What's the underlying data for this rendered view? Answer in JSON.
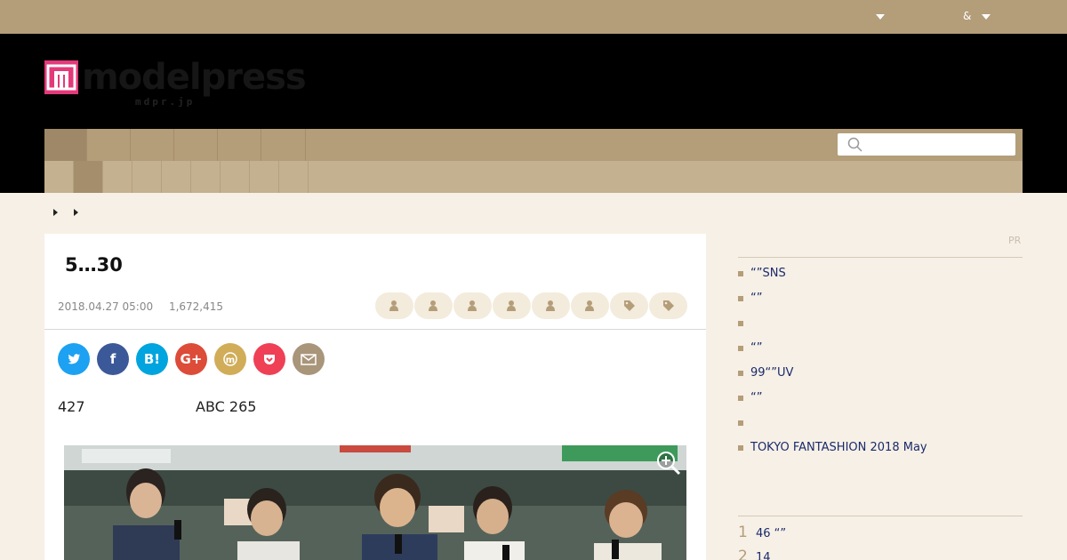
{
  "topbar": {
    "right_link_amp": "&"
  },
  "header": {
    "logo_word": "modelpress",
    "logo_sub": "mdpr.jp"
  },
  "search": {
    "placeholder": ""
  },
  "colors": {
    "topbar": "#b49d79",
    "header": "#000000",
    "nav_primary": "#b49d79",
    "nav_secondary": "#c4b190",
    "page_bg": "#f7f0e6",
    "logo_pink": "#e4397a",
    "link_blue": "#1a2a6c"
  },
  "article": {
    "title": "5…30",
    "date": "2018.04.27 05:00",
    "views": "1,672,415",
    "lead_left": "427",
    "lead_right": "ABC 265",
    "tag_chips": [
      "person-icon",
      "person-icon",
      "person-icon",
      "person-icon",
      "person-icon",
      "person-icon",
      "tag-icon",
      "tag-icon"
    ]
  },
  "share": [
    {
      "name": "twitter",
      "label": "",
      "color": "#1da1f2"
    },
    {
      "name": "facebook",
      "label": "f",
      "color": "#3b5998"
    },
    {
      "name": "hatena",
      "label": "B!",
      "color": "#00a4de"
    },
    {
      "name": "google-plus",
      "label": "G+",
      "color": "#dd4b39"
    },
    {
      "name": "mixi",
      "label": "m",
      "color": "#d1ad59"
    },
    {
      "name": "pocket",
      "label": "",
      "color": "#ef4056"
    },
    {
      "name": "mail",
      "label": "",
      "color": "#a8957a"
    }
  ],
  "sidebar": {
    "pr_label": "PR",
    "items": [
      "“”SNS",
      "“”",
      "",
      "“”",
      "99“”UV",
      "“”",
      "",
      "TOKYO FANTASHION 2018 May"
    ],
    "ranking": [
      {
        "rank": "1",
        "text": "46 “”"
      },
      {
        "rank": "2",
        "text": "14"
      }
    ]
  }
}
